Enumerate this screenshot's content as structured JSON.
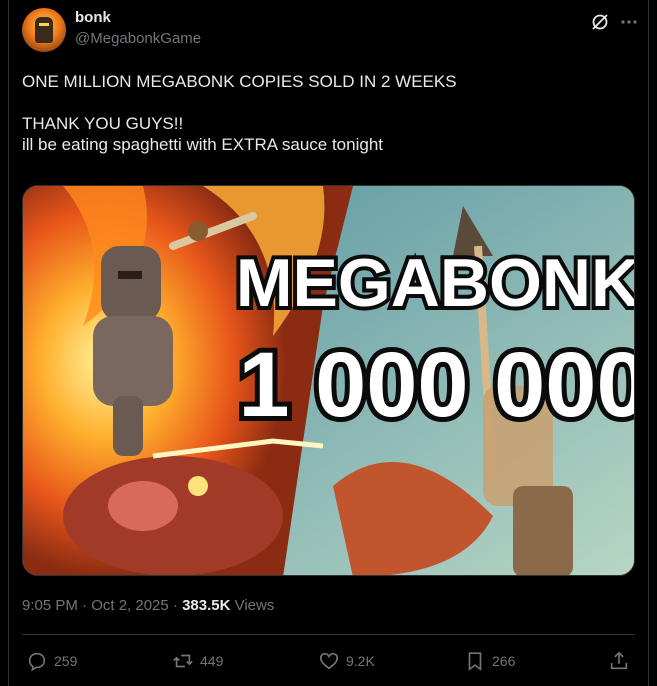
{
  "author": {
    "name": "bonk",
    "handle": "@MegabonkGame"
  },
  "post": {
    "text": "ONE MILLION MEGABONK COPIES SOLD IN 2 WEEKS\n\nTHANK YOU GUYS!!\nill be eating spaghetti with EXTRA sauce tonight"
  },
  "media": {
    "title": "MEGABONK",
    "number": "1 000 000"
  },
  "meta": {
    "timestamp": "9:05 PM · Oct 2, 2025 · ",
    "views_count": "383.5K",
    "views_label": " Views"
  },
  "actions": {
    "replies": "259",
    "reposts": "449",
    "likes": "9.2K",
    "bookmarks": "266"
  },
  "icons": [
    "grok-icon",
    "more-icon",
    "reply-icon",
    "repost-icon",
    "like-icon",
    "bookmark-icon",
    "share-icon"
  ],
  "colors": {
    "background": "#000000",
    "text": "#e7e9ea",
    "secondary": "#71767b",
    "border": "#2f3336"
  }
}
